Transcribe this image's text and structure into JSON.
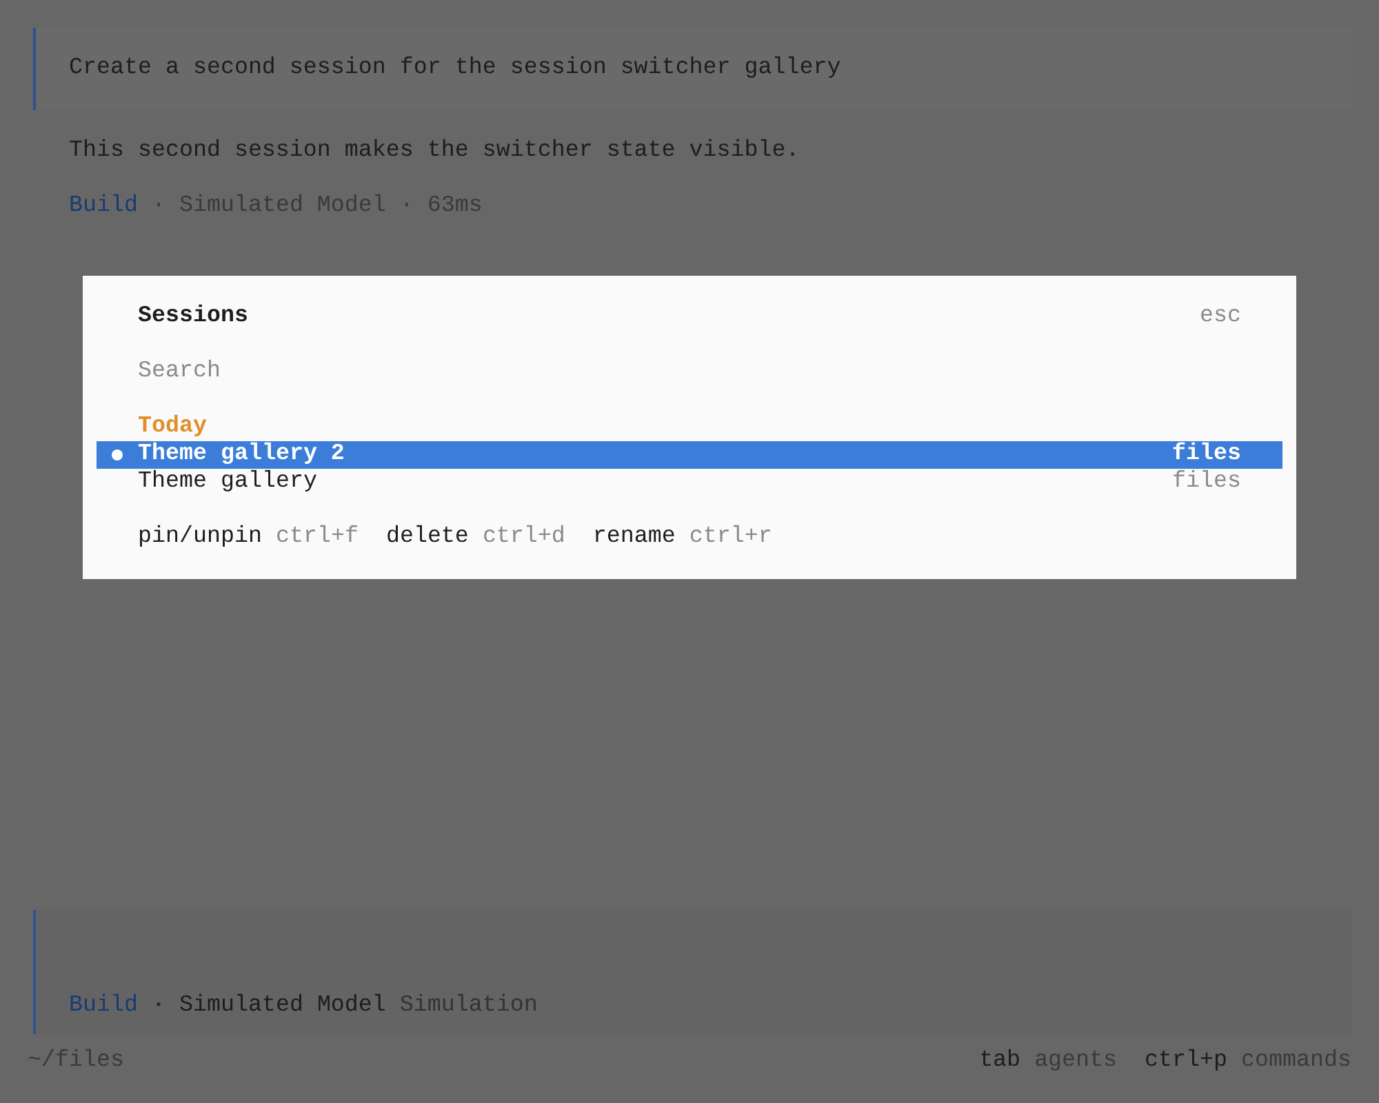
{
  "conversation": {
    "user_message": "Create a second session for the session switcher gallery",
    "reply": "This second session makes the switcher state visible.",
    "reply_footer": {
      "agent": "Build",
      "details": "· Simulated Model · 63ms"
    }
  },
  "dialog": {
    "title": "Sessions",
    "close_hint": "esc",
    "search": {
      "placeholder": "Search"
    },
    "groups": [
      {
        "label": "Today",
        "sessions": [
          {
            "title": "Theme gallery 2",
            "directory": "files",
            "selected": true
          },
          {
            "title": "Theme gallery",
            "directory": "files",
            "selected": false
          }
        ]
      }
    ],
    "shortcuts": [
      {
        "label": "pin/unpin",
        "key": "ctrl+f"
      },
      {
        "label": "delete",
        "key": "ctrl+d"
      },
      {
        "label": "rename",
        "key": "ctrl+r"
      }
    ]
  },
  "prompt": {
    "agent": "Build",
    "separator": "·",
    "model": "Simulated Model",
    "provider": "Simulation"
  },
  "status_bar": {
    "path": "~/files",
    "shortcuts": [
      {
        "key": "tab",
        "label": "agents"
      },
      {
        "key": "ctrl+p",
        "label": "commands"
      }
    ]
  }
}
